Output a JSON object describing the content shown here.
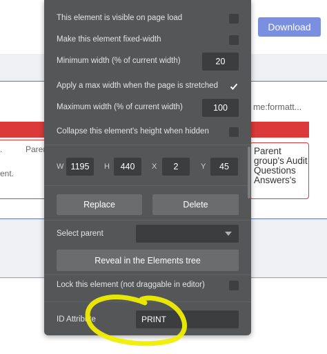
{
  "header": {
    "download_label": "Download"
  },
  "background": {
    "left_col_texts": [
      ".",
      "Paren",
      "ent."
    ],
    "right_top_text": "me:formatt...",
    "right_parent_text": "Parent group's Audit Questions Answers's"
  },
  "panel": {
    "visible_on_load_label": "This element is visible on page load",
    "fixed_width_label": "Make this element fixed-width",
    "min_width_label": "Minimum width (% of current width)",
    "min_width_value": "20",
    "max_width_label": "Apply a max width when the page is stretched",
    "max_width_checked": true,
    "max_width_value_label": "Maximum width (% of current width)",
    "max_width_value": "100",
    "collapse_label": "Collapse this element's height when hidden",
    "dimensions": {
      "w_label": "W",
      "w_value": "1195",
      "h_label": "H",
      "h_value": "440",
      "x_label": "X",
      "x_value": "2",
      "y_label": "Y",
      "y_value": "45"
    },
    "replace_label": "Replace",
    "delete_label": "Delete",
    "select_parent_label": "Select parent",
    "reveal_label": "Reveal in the Elements tree",
    "lock_label": "Lock this element (not draggable in editor)",
    "id_attr_label": "ID Attribute",
    "id_attr_value": "PRINT"
  },
  "colors": {
    "panel_bg": "#545658",
    "accent_red": "#dc3a3a",
    "download_bg": "#7b8fe0",
    "highlight": "#f0ee00"
  }
}
